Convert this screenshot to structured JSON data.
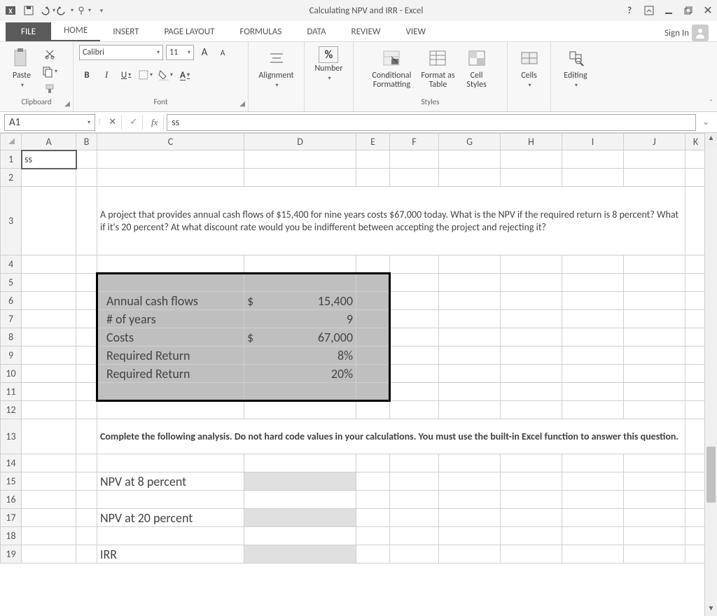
{
  "titlebar": {
    "title": "Calculating NPV and IRR - Excel"
  },
  "ribbon": {
    "tabs": [
      "FILE",
      "HOME",
      "INSERT",
      "PAGE LAYOUT",
      "FORMULAS",
      "DATA",
      "REVIEW",
      "VIEW"
    ],
    "signin": "Sign In",
    "help": "?",
    "font": {
      "name": "Calibri",
      "size": "11",
      "increase": "A",
      "decrease": "A"
    },
    "groups": {
      "clipboard": "Clipboard",
      "font": "Font",
      "alignment": "Alignment",
      "number": "Number",
      "styles": "Styles",
      "cells": "Cells",
      "editing": "Editing",
      "paste": "Paste",
      "conditional": "Conditional\nFormatting",
      "formatas": "Format as\nTable",
      "cellstyles": "Cell\nStyles",
      "percent": "%"
    }
  },
  "formula_bar": {
    "namebox": "A1",
    "value": "ss",
    "fx": "fx"
  },
  "columns": [
    "A",
    "B",
    "C",
    "D",
    "E",
    "F",
    "G",
    "H",
    "I",
    "J",
    "K"
  ],
  "rows": [
    "1",
    "2",
    "3",
    "4",
    "5",
    "6",
    "7",
    "8",
    "9",
    "10",
    "11",
    "12",
    "13",
    "14",
    "15",
    "16",
    "17",
    "18",
    "19"
  ],
  "cells": {
    "A1": "ss",
    "C3": "A project that provides annual cash flows of $15,400 for nine years costs $67,000 today. What is the NPV if the required return is 8 percent? What if it's 20 percent? At what discount rate would you be indifferent between accepting the project and rejecting it?",
    "C6": "Annual cash flows",
    "D6s": "$",
    "D6v": "15,400",
    "C7": "# of years",
    "D7v": "9",
    "C8": "Costs",
    "D8s": "$",
    "D8v": "67,000",
    "C9": "Required Return",
    "D9v": "8%",
    "C10": "Required Return",
    "D10v": "20%",
    "C13": "Complete the following analysis. Do not hard code values in your calculations. You must use the built-in Excel function to answer this question.",
    "C15": "NPV at 8 percent",
    "C17": "NPV at 20 percent",
    "C19": "IRR"
  }
}
